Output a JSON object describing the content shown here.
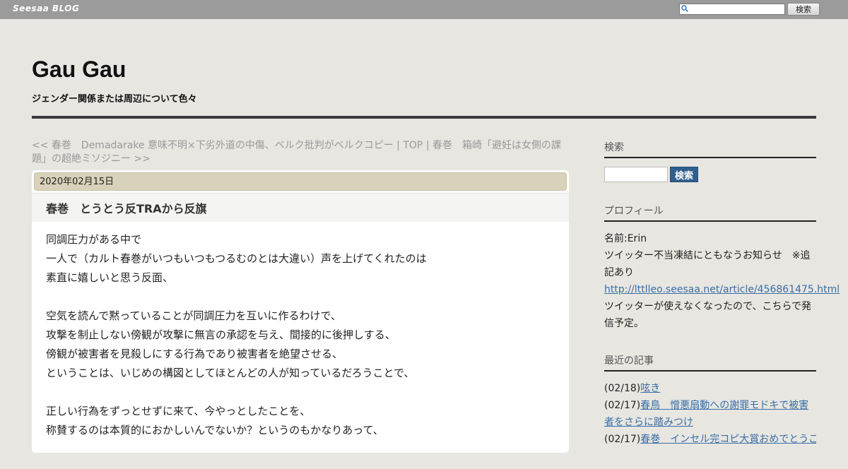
{
  "topbar": {
    "logo": "Seesaa BLOG",
    "search_placeholder": "",
    "search_button": "検索"
  },
  "header": {
    "title": "Gau Gau",
    "description": "ジェンダー関係または周辺について色々"
  },
  "topics": {
    "prev_link": "<< 春巻　Demadarake 意味不明×下劣外道の中傷、ベルク批判がベルクコピー",
    "sep1": " | ",
    "top_link": "TOP",
    "sep2": " | ",
    "next_link": "春巻　箱崎「避妊は女側の課題」の超絶ミソジニー >>"
  },
  "article": {
    "date": "2020年02月15日",
    "title": "春巻　とうとう反TRAから反旗",
    "body": [
      "同調圧力がある中で",
      "一人で（カルト春巻がいつもいつもつるむのとは大違い）声を上げてくれたのは",
      "素直に嬉しいと思う反面、",
      "",
      "空気を読んで黙っていることが同調圧力を互いに作るわけで、",
      "攻撃を制止しない傍観が攻撃に無言の承認を与え、間接的に後押しする、",
      "傍観が被害者を見殺しにする行為であり被害者を絶望させる、",
      "ということは、いじめの構図としてほとんどの人が知っているだろうことで、",
      "",
      "正しい行為をずっとせずに来て、今やっとしたことを、",
      "称賛するのは本質的におかしいんでないか？というのもかなりあって、"
    ]
  },
  "sidebar": {
    "search": {
      "heading": "検索",
      "button": "検索"
    },
    "profile": {
      "heading": "プロフィール",
      "name": "名前:Erin",
      "notice": "ツイッター不当凍結にともなうお知らせ　※追記あり",
      "link": "http://lttlleo.seesaa.net/article/456861475.html",
      "note": "ツイッターが使えなくなったので、こちらで発信予定。"
    },
    "recent": {
      "heading": "最近の記事",
      "items": [
        {
          "date": "(02/18)",
          "title": "呟き"
        },
        {
          "date": "(02/17)",
          "title": "春鳥　憎悪扇動への謝罪モドキで被害者をさらに踏みつけ"
        },
        {
          "date": "(02/17)",
          "title": "春巻　インセル完コピ大賞おめでとうご"
        }
      ]
    }
  }
}
